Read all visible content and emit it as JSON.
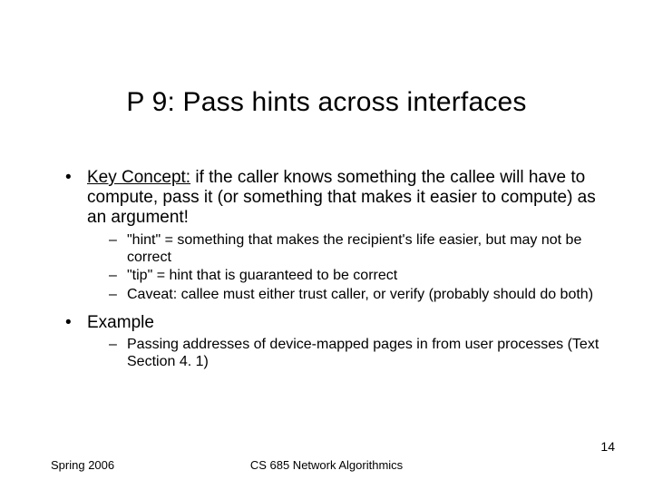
{
  "title": "P 9: Pass hints across interfaces",
  "bullets": {
    "kc_label": "Key Concept:",
    "kc_rest": " if the caller knows something the callee will have to compute, pass it (or something that makes it easier to compute) as an argument!",
    "kc_subs": [
      "\"hint\"  = something that makes the recipient's life easier, but may not be correct",
      "\"tip\" = hint that is guaranteed to be correct",
      "Caveat: callee must either trust caller, or verify (probably should do both)"
    ],
    "example_label": "Example",
    "example_subs": [
      "Passing addresses of device-mapped pages in from user processes (Text Section 4. 1)"
    ]
  },
  "footer": {
    "left": "Spring 2006",
    "center": "CS 685 Network Algorithmics",
    "page": "14"
  }
}
